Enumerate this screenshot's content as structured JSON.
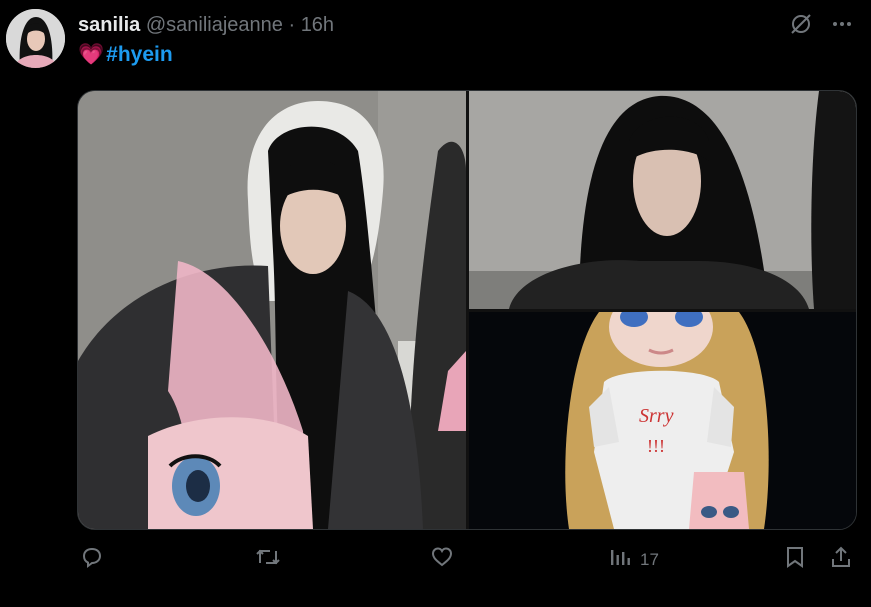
{
  "post": {
    "display_name": "sanilia",
    "handle": "@saniliajeanne",
    "separator": "·",
    "time": "16h",
    "emoji": "💗",
    "hashtag": "#hyein"
  },
  "actions": {
    "views_count": "17"
  },
  "icons": [
    "grok-icon",
    "more-icon",
    "reply-icon",
    "retweet-icon",
    "like-icon",
    "views-icon",
    "bookmark-icon",
    "share-icon"
  ],
  "colors": {
    "accent": "#1d9bf0",
    "muted": "#71767b",
    "text": "#e7e9ea",
    "background": "#000000"
  }
}
